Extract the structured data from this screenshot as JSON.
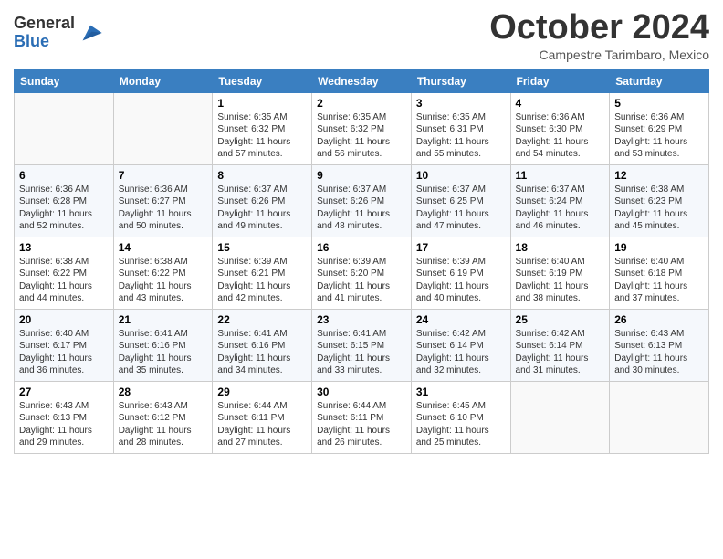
{
  "logo": {
    "general": "General",
    "blue": "Blue"
  },
  "title": "October 2024",
  "subtitle": "Campestre Tarimbaro, Mexico",
  "days_of_week": [
    "Sunday",
    "Monday",
    "Tuesday",
    "Wednesday",
    "Thursday",
    "Friday",
    "Saturday"
  ],
  "weeks": [
    [
      {
        "day": "",
        "sunrise": "",
        "sunset": "",
        "daylight": ""
      },
      {
        "day": "",
        "sunrise": "",
        "sunset": "",
        "daylight": ""
      },
      {
        "day": "1",
        "sunrise": "Sunrise: 6:35 AM",
        "sunset": "Sunset: 6:32 PM",
        "daylight": "Daylight: 11 hours and 57 minutes."
      },
      {
        "day": "2",
        "sunrise": "Sunrise: 6:35 AM",
        "sunset": "Sunset: 6:32 PM",
        "daylight": "Daylight: 11 hours and 56 minutes."
      },
      {
        "day": "3",
        "sunrise": "Sunrise: 6:35 AM",
        "sunset": "Sunset: 6:31 PM",
        "daylight": "Daylight: 11 hours and 55 minutes."
      },
      {
        "day": "4",
        "sunrise": "Sunrise: 6:36 AM",
        "sunset": "Sunset: 6:30 PM",
        "daylight": "Daylight: 11 hours and 54 minutes."
      },
      {
        "day": "5",
        "sunrise": "Sunrise: 6:36 AM",
        "sunset": "Sunset: 6:29 PM",
        "daylight": "Daylight: 11 hours and 53 minutes."
      }
    ],
    [
      {
        "day": "6",
        "sunrise": "Sunrise: 6:36 AM",
        "sunset": "Sunset: 6:28 PM",
        "daylight": "Daylight: 11 hours and 52 minutes."
      },
      {
        "day": "7",
        "sunrise": "Sunrise: 6:36 AM",
        "sunset": "Sunset: 6:27 PM",
        "daylight": "Daylight: 11 hours and 50 minutes."
      },
      {
        "day": "8",
        "sunrise": "Sunrise: 6:37 AM",
        "sunset": "Sunset: 6:26 PM",
        "daylight": "Daylight: 11 hours and 49 minutes."
      },
      {
        "day": "9",
        "sunrise": "Sunrise: 6:37 AM",
        "sunset": "Sunset: 6:26 PM",
        "daylight": "Daylight: 11 hours and 48 minutes."
      },
      {
        "day": "10",
        "sunrise": "Sunrise: 6:37 AM",
        "sunset": "Sunset: 6:25 PM",
        "daylight": "Daylight: 11 hours and 47 minutes."
      },
      {
        "day": "11",
        "sunrise": "Sunrise: 6:37 AM",
        "sunset": "Sunset: 6:24 PM",
        "daylight": "Daylight: 11 hours and 46 minutes."
      },
      {
        "day": "12",
        "sunrise": "Sunrise: 6:38 AM",
        "sunset": "Sunset: 6:23 PM",
        "daylight": "Daylight: 11 hours and 45 minutes."
      }
    ],
    [
      {
        "day": "13",
        "sunrise": "Sunrise: 6:38 AM",
        "sunset": "Sunset: 6:22 PM",
        "daylight": "Daylight: 11 hours and 44 minutes."
      },
      {
        "day": "14",
        "sunrise": "Sunrise: 6:38 AM",
        "sunset": "Sunset: 6:22 PM",
        "daylight": "Daylight: 11 hours and 43 minutes."
      },
      {
        "day": "15",
        "sunrise": "Sunrise: 6:39 AM",
        "sunset": "Sunset: 6:21 PM",
        "daylight": "Daylight: 11 hours and 42 minutes."
      },
      {
        "day": "16",
        "sunrise": "Sunrise: 6:39 AM",
        "sunset": "Sunset: 6:20 PM",
        "daylight": "Daylight: 11 hours and 41 minutes."
      },
      {
        "day": "17",
        "sunrise": "Sunrise: 6:39 AM",
        "sunset": "Sunset: 6:19 PM",
        "daylight": "Daylight: 11 hours and 40 minutes."
      },
      {
        "day": "18",
        "sunrise": "Sunrise: 6:40 AM",
        "sunset": "Sunset: 6:19 PM",
        "daylight": "Daylight: 11 hours and 38 minutes."
      },
      {
        "day": "19",
        "sunrise": "Sunrise: 6:40 AM",
        "sunset": "Sunset: 6:18 PM",
        "daylight": "Daylight: 11 hours and 37 minutes."
      }
    ],
    [
      {
        "day": "20",
        "sunrise": "Sunrise: 6:40 AM",
        "sunset": "Sunset: 6:17 PM",
        "daylight": "Daylight: 11 hours and 36 minutes."
      },
      {
        "day": "21",
        "sunrise": "Sunrise: 6:41 AM",
        "sunset": "Sunset: 6:16 PM",
        "daylight": "Daylight: 11 hours and 35 minutes."
      },
      {
        "day": "22",
        "sunrise": "Sunrise: 6:41 AM",
        "sunset": "Sunset: 6:16 PM",
        "daylight": "Daylight: 11 hours and 34 minutes."
      },
      {
        "day": "23",
        "sunrise": "Sunrise: 6:41 AM",
        "sunset": "Sunset: 6:15 PM",
        "daylight": "Daylight: 11 hours and 33 minutes."
      },
      {
        "day": "24",
        "sunrise": "Sunrise: 6:42 AM",
        "sunset": "Sunset: 6:14 PM",
        "daylight": "Daylight: 11 hours and 32 minutes."
      },
      {
        "day": "25",
        "sunrise": "Sunrise: 6:42 AM",
        "sunset": "Sunset: 6:14 PM",
        "daylight": "Daylight: 11 hours and 31 minutes."
      },
      {
        "day": "26",
        "sunrise": "Sunrise: 6:43 AM",
        "sunset": "Sunset: 6:13 PM",
        "daylight": "Daylight: 11 hours and 30 minutes."
      }
    ],
    [
      {
        "day": "27",
        "sunrise": "Sunrise: 6:43 AM",
        "sunset": "Sunset: 6:13 PM",
        "daylight": "Daylight: 11 hours and 29 minutes."
      },
      {
        "day": "28",
        "sunrise": "Sunrise: 6:43 AM",
        "sunset": "Sunset: 6:12 PM",
        "daylight": "Daylight: 11 hours and 28 minutes."
      },
      {
        "day": "29",
        "sunrise": "Sunrise: 6:44 AM",
        "sunset": "Sunset: 6:11 PM",
        "daylight": "Daylight: 11 hours and 27 minutes."
      },
      {
        "day": "30",
        "sunrise": "Sunrise: 6:44 AM",
        "sunset": "Sunset: 6:11 PM",
        "daylight": "Daylight: 11 hours and 26 minutes."
      },
      {
        "day": "31",
        "sunrise": "Sunrise: 6:45 AM",
        "sunset": "Sunset: 6:10 PM",
        "daylight": "Daylight: 11 hours and 25 minutes."
      },
      {
        "day": "",
        "sunrise": "",
        "sunset": "",
        "daylight": ""
      },
      {
        "day": "",
        "sunrise": "",
        "sunset": "",
        "daylight": ""
      }
    ]
  ]
}
